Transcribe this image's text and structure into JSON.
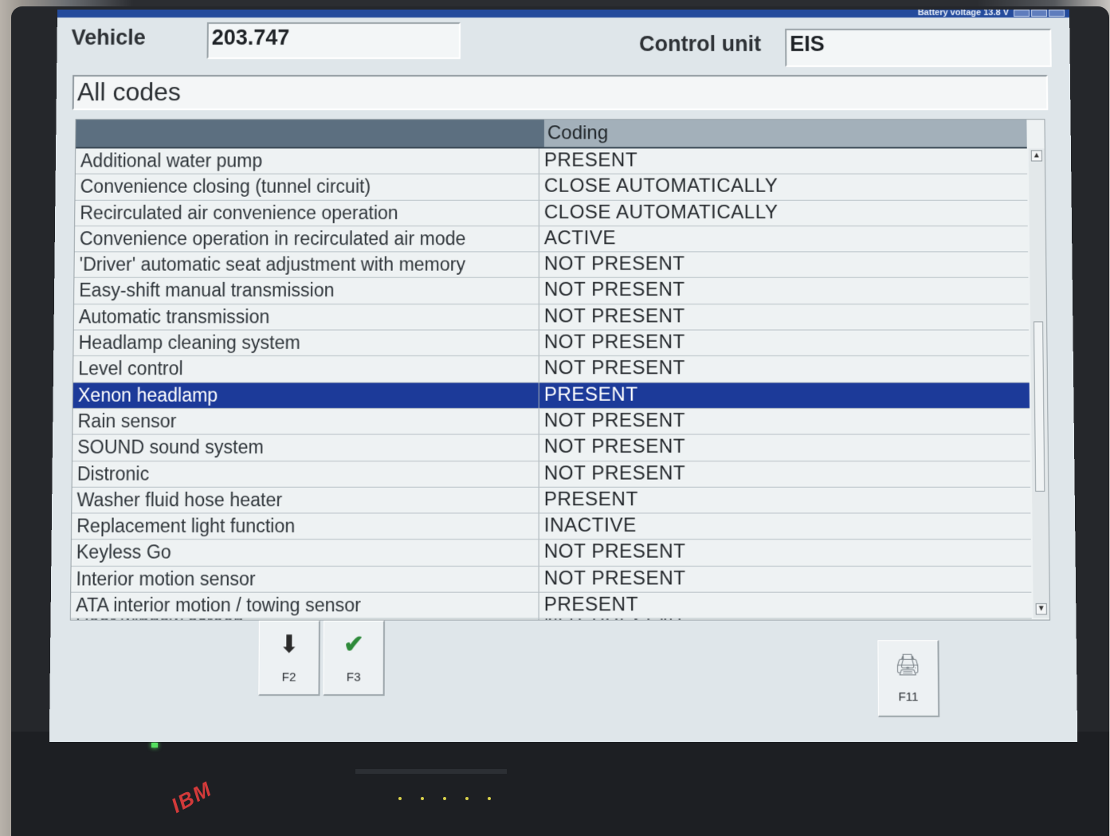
{
  "header": {
    "status": "Battery voltage 13.8 V",
    "vehicle_label": "Vehicle",
    "vehicle_value": "203.747",
    "control_unit_label": "Control unit",
    "control_unit_value": "EIS"
  },
  "filter": "All codes",
  "table": {
    "columns": [
      "",
      "Coding"
    ],
    "rows": [
      {
        "name": "Additional water pump",
        "value": "PRESENT"
      },
      {
        "name": "Convenience closing (tunnel circuit)",
        "value": "CLOSE AUTOMATICALLY"
      },
      {
        "name": "Recirculated air convenience operation",
        "value": "CLOSE AUTOMATICALLY"
      },
      {
        "name": "Convenience operation in recirculated air mode",
        "value": "ACTIVE"
      },
      {
        "name": "'Driver' automatic seat adjustment with memory",
        "value": "NOT PRESENT"
      },
      {
        "name": "Easy-shift manual transmission",
        "value": "NOT PRESENT"
      },
      {
        "name": "Automatic transmission",
        "value": "NOT PRESENT"
      },
      {
        "name": "Headlamp cleaning system",
        "value": "NOT PRESENT"
      },
      {
        "name": "Level control",
        "value": "NOT PRESENT"
      },
      {
        "name": "Xenon headlamp",
        "value": "PRESENT"
      },
      {
        "name": "Rain sensor",
        "value": "NOT PRESENT"
      },
      {
        "name": "SOUND sound system",
        "value": "NOT PRESENT"
      },
      {
        "name": "Distronic",
        "value": "NOT PRESENT"
      },
      {
        "name": "Washer fluid hose heater",
        "value": "PRESENT"
      },
      {
        "name": "Replacement light function",
        "value": "INACTIVE"
      },
      {
        "name": "Keyless Go",
        "value": "NOT PRESENT"
      },
      {
        "name": "Interior motion sensor",
        "value": "NOT PRESENT"
      },
      {
        "name": "ATA interior motion / towing sensor",
        "value": "PRESENT"
      },
      {
        "name": "Rear window screen",
        "value": "NOT PRESENT"
      }
    ],
    "selected_index": 9
  },
  "function_keys": {
    "f2": "F2",
    "f3": "F3",
    "f11": "F11"
  },
  "laptop": {
    "logo": "IBM"
  },
  "colors": {
    "selection": "#1c3a99",
    "header_bg": "#5c6f80",
    "title_strip": "#244b9c"
  }
}
